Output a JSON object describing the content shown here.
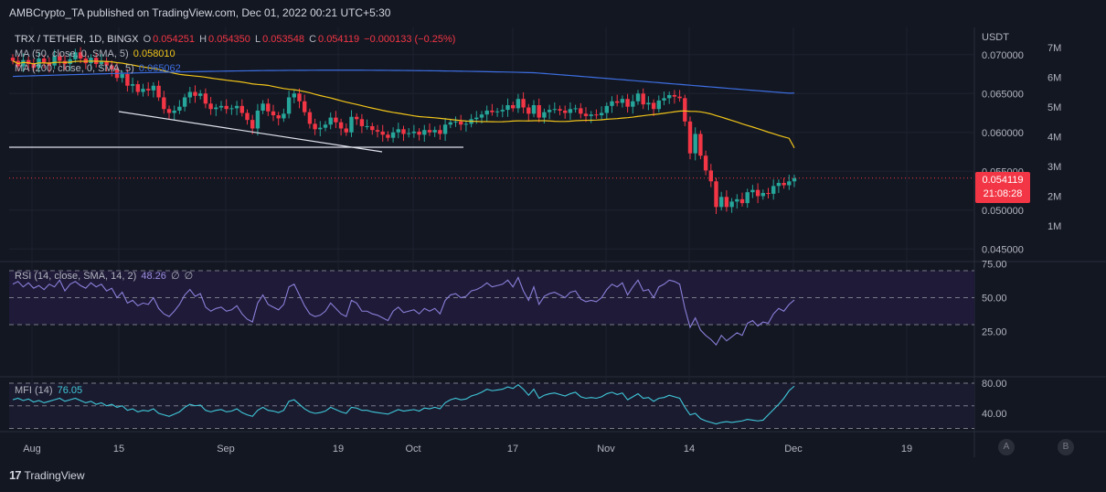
{
  "header": {
    "publisher": "AMBCrypto_TA published on TradingView.com, Dec 01, 2022 00:21 UTC+5:30"
  },
  "legend": {
    "symbol": "TRX / TETHER, 1D, BINGX",
    "o_label": "O",
    "o_value": "0.054251",
    "h_label": "H",
    "h_value": "0.054350",
    "l_label": "L",
    "l_value": "0.053548",
    "c_label": "C",
    "c_value": "0.054119",
    "change": "−0.000133 (−0.25%)",
    "ma50_label": "MA (50, close, 0, SMA, 5)",
    "ma50_value": "0.058010",
    "ma200_label": "MA (200, close, 0, SMA, 5)",
    "ma200_value": "0.065062"
  },
  "price_axis": {
    "currency": "USDT",
    "ticks": [
      "0.070000",
      "0.065000",
      "0.060000",
      "0.055000",
      "0.050000",
      "0.045000"
    ],
    "volume_ticks": [
      "7M",
      "6M",
      "5M",
      "4M",
      "3M",
      "2M",
      "1M"
    ],
    "last_price": "0.054119",
    "countdown": "21:08:28"
  },
  "rsi": {
    "label": "RSI (14, close, SMA, 14, 2)",
    "value": "48.26",
    "extra1": "∅",
    "extra2": "∅",
    "ticks": [
      "75.00",
      "50.00",
      "25.00"
    ]
  },
  "mfi": {
    "label": "MFI (14)",
    "value": "76.05",
    "ticks": [
      "80.00",
      "40.00"
    ]
  },
  "time_axis": [
    "Aug",
    "15",
    "Sep",
    "19",
    "Oct",
    "17",
    "Nov",
    "14",
    "Dec",
    "19"
  ],
  "buttons": {
    "a": "A",
    "b": "B"
  },
  "footer": {
    "brand": "TradingView",
    "logo": "17"
  },
  "colors": {
    "up": "#26a69a",
    "down": "#f23645",
    "ma50": "#f0c419",
    "ma200": "#3d6ee0",
    "rsi": "#8a7fd8",
    "mfi": "#3fc8d8",
    "bg": "#131722"
  },
  "chart_data": {
    "type": "candlestick",
    "symbol": "TRX / TETHER",
    "interval": "1D",
    "y_range": [
      0.0435,
      0.0735
    ],
    "closes": [
      0.0692,
      0.0685,
      0.0693,
      0.0688,
      0.0683,
      0.0695,
      0.069,
      0.0686,
      0.0698,
      0.0692,
      0.0688,
      0.0694,
      0.0703,
      0.0695,
      0.0689,
      0.0696,
      0.0688,
      0.0692,
      0.0686,
      0.0681,
      0.067,
      0.0675,
      0.066,
      0.0662,
      0.0652,
      0.0656,
      0.0654,
      0.066,
      0.0645,
      0.063,
      0.0625,
      0.0628,
      0.0633,
      0.0645,
      0.0652,
      0.0647,
      0.065,
      0.0637,
      0.063,
      0.0632,
      0.0634,
      0.063,
      0.0631,
      0.0634,
      0.0625,
      0.0616,
      0.0605,
      0.0628,
      0.0637,
      0.0627,
      0.0622,
      0.0618,
      0.0624,
      0.0645,
      0.065,
      0.064,
      0.0626,
      0.0611,
      0.0604,
      0.0606,
      0.061,
      0.0619,
      0.0613,
      0.0605,
      0.06,
      0.062,
      0.0617,
      0.0608,
      0.0608,
      0.0603,
      0.0601,
      0.0597,
      0.0593,
      0.06,
      0.0604,
      0.0598,
      0.0599,
      0.0601,
      0.0597,
      0.0603,
      0.06,
      0.0603,
      0.0598,
      0.061,
      0.0613,
      0.0614,
      0.061,
      0.0611,
      0.0617,
      0.0619,
      0.0623,
      0.0628,
      0.0626,
      0.0627,
      0.0629,
      0.0635,
      0.0631,
      0.0643,
      0.0632,
      0.0624,
      0.0635,
      0.0619,
      0.0626,
      0.0629,
      0.063,
      0.0628,
      0.0625,
      0.063,
      0.0631,
      0.0624,
      0.0621,
      0.0623,
      0.0622,
      0.0625,
      0.0634,
      0.064,
      0.0638,
      0.0643,
      0.0633,
      0.064,
      0.065,
      0.0636,
      0.0638,
      0.063,
      0.0641,
      0.0644,
      0.0648,
      0.0646,
      0.0644,
      0.0614,
      0.0573,
      0.0598,
      0.057,
      0.0551,
      0.0537,
      0.0504,
      0.0517,
      0.0504,
      0.0511,
      0.0514,
      0.0509,
      0.0523,
      0.0526,
      0.0518,
      0.0522,
      0.0521,
      0.0531,
      0.0535,
      0.0532,
      0.0537,
      0.0541
    ],
    "ma50_value": 0.05801,
    "ma200_value": 0.065062,
    "last_close": 0.054119,
    "rsi": {
      "range": [
        0,
        100
      ],
      "bands": [
        70,
        50,
        30
      ],
      "last": 48.26,
      "values": [
        60,
        62,
        58,
        61,
        57,
        59,
        56,
        60,
        58,
        63,
        55,
        60,
        62,
        59,
        57,
        61,
        58,
        60,
        55,
        57,
        50,
        54,
        46,
        48,
        44,
        46,
        45,
        50,
        42,
        38,
        36,
        40,
        45,
        52,
        56,
        51,
        53,
        43,
        40,
        42,
        43,
        40,
        41,
        44,
        38,
        34,
        32,
        46,
        52,
        45,
        43,
        41,
        45,
        58,
        60,
        52,
        44,
        38,
        36,
        37,
        40,
        46,
        42,
        38,
        36,
        48,
        46,
        40,
        40,
        38,
        37,
        35,
        33,
        40,
        43,
        39,
        40,
        41,
        38,
        42,
        40,
        42,
        38,
        48,
        52,
        53,
        50,
        51,
        55,
        56,
        58,
        61,
        58,
        59,
        60,
        63,
        58,
        65,
        55,
        48,
        58,
        45,
        51,
        53,
        54,
        52,
        50,
        54,
        55,
        49,
        47,
        48,
        47,
        50,
        56,
        60,
        58,
        61,
        52,
        58,
        63,
        55,
        56,
        50,
        58,
        60,
        63,
        62,
        60,
        42,
        28,
        35,
        26,
        22,
        19,
        15,
        22,
        18,
        21,
        24,
        22,
        31,
        33,
        29,
        32,
        31,
        38,
        42,
        40,
        45,
        48.26
      ]
    },
    "mfi": {
      "range": [
        20,
        90
      ],
      "bands": [
        80,
        50,
        30
      ],
      "last": 76.05,
      "values": [
        58,
        60,
        57,
        59,
        55,
        57,
        54,
        56,
        58,
        60,
        56,
        58,
        60,
        57,
        54,
        56,
        52,
        54,
        50,
        52,
        48,
        50,
        44,
        46,
        42,
        44,
        43,
        46,
        40,
        38,
        36,
        39,
        42,
        48,
        52,
        50,
        51,
        44,
        42,
        44,
        45,
        42,
        43,
        46,
        41,
        38,
        36,
        44,
        48,
        44,
        43,
        41,
        44,
        56,
        58,
        52,
        46,
        42,
        40,
        41,
        43,
        48,
        45,
        42,
        40,
        48,
        47,
        44,
        44,
        42,
        41,
        40,
        39,
        42,
        45,
        43,
        44,
        45,
        43,
        47,
        46,
        48,
        46,
        54,
        58,
        60,
        58,
        59,
        63,
        65,
        68,
        72,
        70,
        71,
        72,
        75,
        73,
        78,
        72,
        64,
        72,
        60,
        64,
        66,
        67,
        65,
        63,
        66,
        68,
        62,
        60,
        61,
        60,
        62,
        66,
        68,
        65,
        67,
        58,
        62,
        66,
        60,
        61,
        56,
        60,
        61,
        64,
        62,
        60,
        48,
        38,
        40,
        33,
        30,
        28,
        26,
        28,
        29,
        28,
        29,
        30,
        32,
        31,
        30,
        31,
        38,
        45,
        52,
        60,
        70,
        76.05
      ]
    }
  }
}
